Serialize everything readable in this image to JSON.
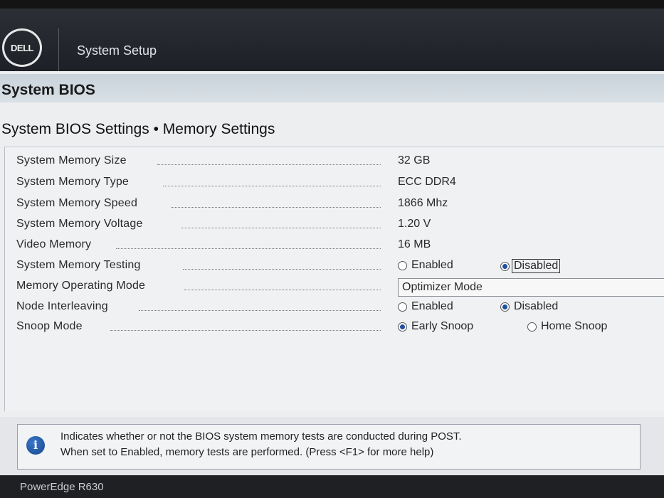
{
  "header": {
    "logo_text": "DELL",
    "title": "System Setup"
  },
  "section": {
    "title": "System BIOS"
  },
  "page": {
    "heading": "System BIOS Settings • Memory Settings"
  },
  "settings": [
    {
      "label": "System Memory Size",
      "value": "32 GB"
    },
    {
      "label": "System Memory Type",
      "value": "ECC DDR4"
    },
    {
      "label": "System Memory Speed",
      "value": "1866 Mhz"
    },
    {
      "label": "System Memory Voltage",
      "value": "1.20 V"
    },
    {
      "label": "Video Memory",
      "value": "16 MB"
    },
    {
      "label": "System Memory Testing",
      "options": [
        "Enabled",
        "Disabled"
      ],
      "selected": "Disabled"
    },
    {
      "label": "Memory Operating Mode",
      "value": "Optimizer Mode"
    },
    {
      "label": "Node Interleaving",
      "options": [
        "Enabled",
        "Disabled"
      ],
      "selected": "Disabled"
    },
    {
      "label": "Snoop Mode",
      "options": [
        "Early Snoop",
        "Home Snoop"
      ],
      "selected": "Early Snoop"
    }
  ],
  "help": {
    "icon": "info-icon",
    "line1": "Indicates whether or not the BIOS system memory tests are conducted during POST.",
    "line2": "When set to Enabled, memory tests are performed. (Press <F1> for more help)"
  },
  "footer": {
    "model": "PowerEdge R630"
  },
  "colors": {
    "header_bg": "#23262c",
    "section_bar": "#d0d9e0",
    "page_bg": "#eceef0",
    "radio_selected": "#1f4fa0"
  }
}
